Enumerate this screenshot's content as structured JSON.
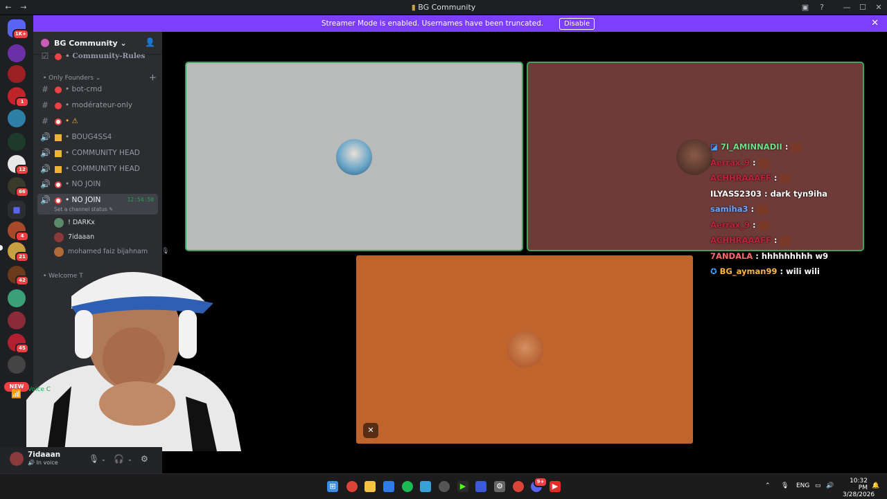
{
  "window": {
    "title": "BG Community",
    "nav_back": "←",
    "nav_forward": "→"
  },
  "banner": {
    "message": "Streamer Mode is enabled. Usernames have been truncated.",
    "disable_label": "Disable",
    "close": "✕"
  },
  "rail": {
    "badges": [
      "1K+",
      "1",
      "12",
      "66",
      "4",
      "21",
      "42",
      "45"
    ],
    "new_label": "NEW"
  },
  "sidebar": {
    "guild_name": "BG Community",
    "channels_top": [
      {
        "label": "Community-Rules",
        "emoji_color": "#ed4245"
      }
    ],
    "category_founders": "Only Founders",
    "channels": [
      {
        "icon": "#",
        "label": "bot-cmd",
        "emoji_color": "#ed4245"
      },
      {
        "icon": "#",
        "label": "modérateur-only",
        "emoji_color": "#ed4245"
      },
      {
        "icon": "#",
        "label": "⚠",
        "emoji_color": "#ed4245"
      },
      {
        "icon": "🔊",
        "label": "BOUG4SS4",
        "emoji_color": "#f0b232"
      },
      {
        "icon": "🔊",
        "label": "COMMUNITY HEAD",
        "emoji_color": "#f0b232"
      },
      {
        "icon": "🔊",
        "label": "COMMUNITY HEAD",
        "emoji_color": "#f0b232"
      },
      {
        "icon": "🔊",
        "label": "NO JOIN",
        "emoji_color": "#ed4245"
      }
    ],
    "active_channel": {
      "label": "NO JOIN",
      "timer": "12:54:50",
      "status_hint": "Set a channel status"
    },
    "voice_users": [
      {
        "name": "! DARKx",
        "color": "#5b8a6a"
      },
      {
        "name": "7idaaan",
        "color": "#8a3a3a"
      },
      {
        "name": "mohamed faiz bijahnam",
        "color": "#b06a3a"
      }
    ],
    "category_welcome": "Welcome T"
  },
  "user_panel": {
    "username": "7idaaan",
    "status": "In voice",
    "voice_label": "Voice C"
  },
  "chat_overlay": [
    {
      "user": "7I_AMINNADII",
      "text": "",
      "user_color": "#6fe08a",
      "emote": true
    },
    {
      "user": "Aerrax_9",
      "text": "",
      "user_color": "#c0233a",
      "emote": true
    },
    {
      "user": "ACHHRAAAFF",
      "text": "",
      "user_color": "#c0233a",
      "emote": true
    },
    {
      "user": "ILYASS2303",
      "text": "dark tyn9iha",
      "user_color": "#ffffff",
      "emote": false
    },
    {
      "user": "samiha3",
      "text": "",
      "user_color": "#6ea6ff",
      "emote": true
    },
    {
      "user": "Aerrax_9",
      "text": "",
      "user_color": "#c0233a",
      "emote": true
    },
    {
      "user": "ACHHRAAAFF",
      "text": "",
      "user_color": "#c0233a",
      "emote": true
    },
    {
      "user": "7ANDALA",
      "text": "hhhhhhhhh w9",
      "user_color": "#ff6a6a",
      "emote": false
    },
    {
      "user": "BG_ayman99",
      "text": "wili wili",
      "user_color": "#ffb347",
      "emote": false
    }
  ],
  "taskbar": {
    "lang": "ENG",
    "time": "10:32 PM",
    "date": "3/28/2026",
    "discord_badge": "9+"
  },
  "colors": {
    "streamer_banner": "#7d3fff",
    "speaking_ring": "#3ba55d",
    "tile_gray": "#b8bbb9",
    "tile_maroon": "#6e3b38",
    "tile_orange": "#c0642e"
  }
}
